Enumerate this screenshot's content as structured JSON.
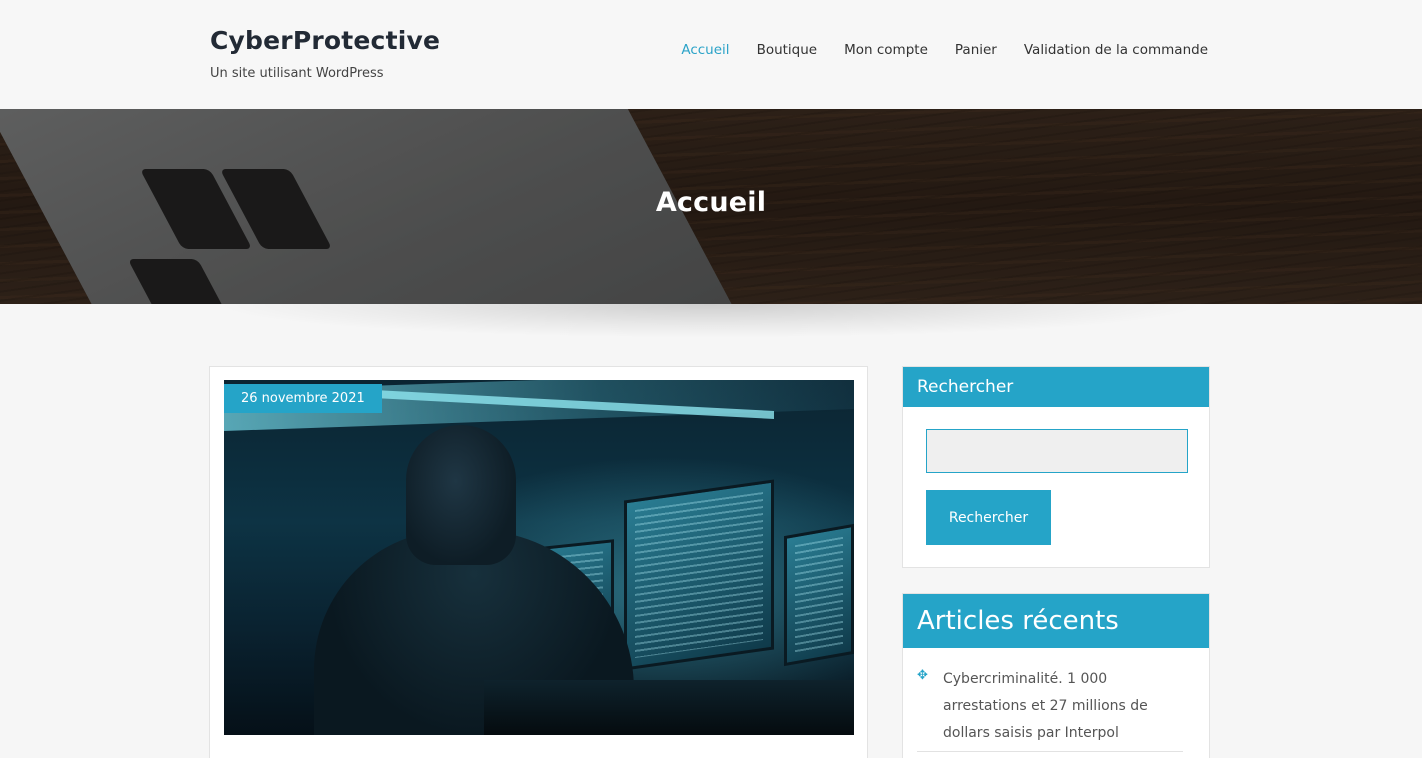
{
  "site": {
    "title": "CyberProtective",
    "tagline": "Un site utilisant WordPress"
  },
  "nav": {
    "items": [
      {
        "label": "Accueil",
        "active": true
      },
      {
        "label": "Boutique",
        "active": false
      },
      {
        "label": "Mon compte",
        "active": false
      },
      {
        "label": "Panier",
        "active": false
      },
      {
        "label": "Validation de la commande",
        "active": false
      }
    ]
  },
  "hero": {
    "title": "Accueil"
  },
  "post": {
    "date": "26 novembre 2021"
  },
  "search_widget": {
    "title": "Rechercher",
    "input_value": "",
    "button_label": "Rechercher"
  },
  "recent_widget": {
    "title": "Articles récents",
    "items": [
      {
        "label": "Cybercriminalité. 1 000 arrestations et 27 millions de dollars saisis par Interpol",
        "icon": "crosshair-icon"
      }
    ]
  },
  "colors": {
    "accent": "#25a4c8",
    "nav_active": "#2ba3c8",
    "title": "#222a35"
  }
}
